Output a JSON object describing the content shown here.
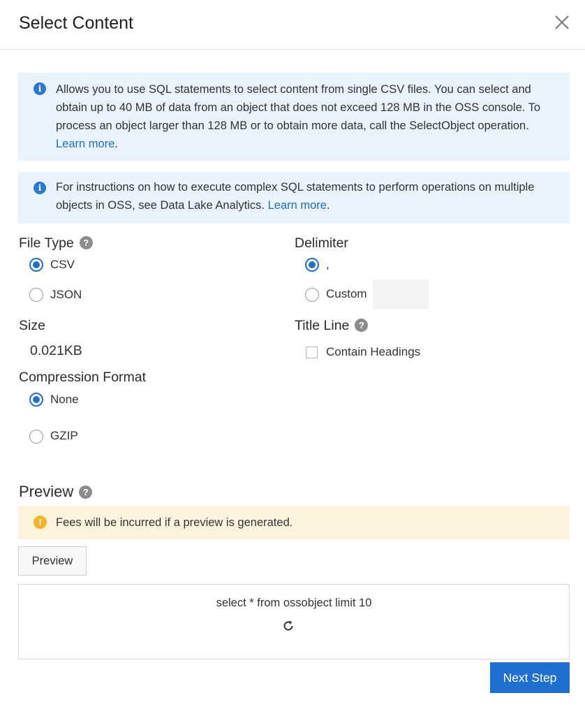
{
  "dialog": {
    "title": "Select Content"
  },
  "notice1": {
    "text": "Allows you to use SQL statements to select content from single CSV files. You can select and obtain up to 40 MB of data from an object that does not exceed 128 MB in the OSS console. To process an object larger than 128 MB or to obtain more data, call the SelectObject operation.",
    "link": "Learn more",
    "suffix": "."
  },
  "notice2": {
    "text": "For instructions on how to execute complex SQL statements to perform operations on multiple objects in OSS, see Data Lake Analytics.",
    "link": "Learn more",
    "suffix": "."
  },
  "file_type": {
    "label": "File Type",
    "options": [
      {
        "label": "CSV",
        "checked": true
      },
      {
        "label": "JSON",
        "checked": false
      }
    ]
  },
  "delimiter": {
    "label": "Delimiter",
    "options": [
      {
        "label": ",",
        "checked": true
      },
      {
        "label": "Custom",
        "checked": false
      }
    ],
    "custom_value": ""
  },
  "size": {
    "label": "Size",
    "value": "0.021KB"
  },
  "title_line": {
    "label": "Title Line",
    "checkbox_label": "Contain Headings",
    "checked": false
  },
  "compression": {
    "label": "Compression Format",
    "options": [
      {
        "label": "None",
        "checked": true
      },
      {
        "label": "GZIP",
        "checked": false
      }
    ]
  },
  "preview": {
    "label": "Preview",
    "warning": "Fees will be incurred if a preview is generated.",
    "button": "Preview",
    "sql": "select * from ossobject limit 10"
  },
  "footer": {
    "next_button": "Next Step"
  },
  "colors": {
    "primary": "#1f6fd1",
    "info_bg": "#e8f3fd",
    "warn_bg": "#fdf3dd",
    "link": "#1e6fc7"
  }
}
